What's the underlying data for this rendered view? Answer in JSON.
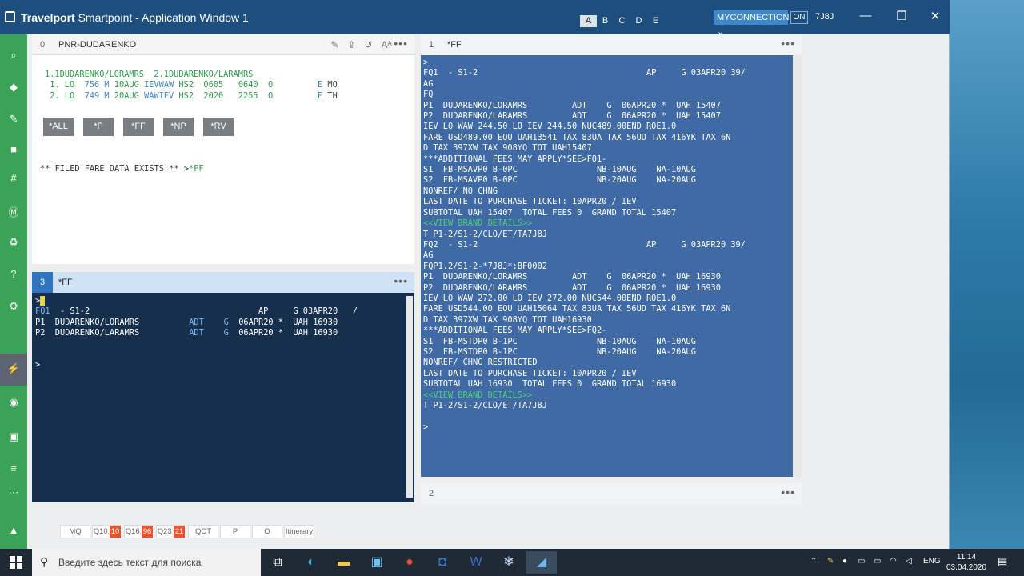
{
  "window": {
    "title_brand": "Travelport",
    "title_rest": " Smartpoint - Application Window 1",
    "tabs": [
      "A",
      "B",
      "C",
      "D",
      "E"
    ],
    "connection": "MYCONNECTION",
    "on_label": "ON",
    "pcc": "7J8J",
    "minimize": "—",
    "restore": "❐",
    "close": "✕"
  },
  "panel0": {
    "num": "0",
    "name": "PNR-DUDARENKO",
    "dots": "•••",
    "line1": "1.1DUDARENKO/LORAMRS  2.1DUDARENKO/LARAMRS",
    "seg1": {
      "idx": " 1. LO  ",
      "flt": "756 M",
      "date": " 10AUG ",
      "route": "IEVWAW",
      "hs": " HS2",
      "rest": "  0605   0640  O         ",
      "e": "E",
      "day": " MO"
    },
    "seg2": {
      "idx": " 2. LO  ",
      "flt": "749 M",
      "date": " 20AUG ",
      "route": "WAWIEV",
      "hs": " HS2",
      "rest": "  2020   2255  O         ",
      "e": "E",
      "day": " TH"
    },
    "buttons": [
      "*ALL",
      "*P",
      "*FF",
      "*NP",
      "*RV"
    ],
    "note_a": "** FILED FARE DATA EXISTS ** >",
    "note_b": "*FF"
  },
  "panel3": {
    "num": "3",
    "name": "*FF",
    "dots": "•••",
    "prompt": ">",
    "fq": "FQ1",
    "fq_rest": "  - S1-2                                  AP     G 03APR20   /",
    "p1a": "P1  DUDARENKO/LORAMRS          ",
    "p1b": "ADT",
    "p1c": "    ",
    "p1d": "G",
    "p1e": "  06APR20 *  UAH 16930",
    "p2a": "P2  DUDARENKO/LARAMRS          ",
    "p2b": "ADT",
    "p2c": "    ",
    "p2d": "G",
    "p2e": "  06APR20 *  UAH 16930",
    "prompt2": ">"
  },
  "panel1": {
    "num": "1",
    "name": "*FF",
    "dots": "•••",
    "lines": [
      ">",
      "FQ1  - S1-2                                  AP     G 03APR20 39/",
      "AG",
      "FQ",
      "P1  DUDARENKO/LORAMRS         ADT    G  06APR20 *  UAH 15407",
      "P2  DUDARENKO/LARAMRS         ADT    G  06APR20 *  UAH 15407",
      "IEV LO WAW 244.50 LO IEV 244.50 NUC489.00END ROE1.0",
      "FARE USD489.00 EQU UAH13541 TAX 83UA TAX 56UD TAX 416YK TAX 6N",
      "D TAX 397XW TAX 908YQ TOT UAH15407",
      "***ADDITIONAL FEES MAY APPLY*SEE>FQ1-",
      "S1  FB-MSAVP0 B-0PC                NB-10AUG    NA-10AUG",
      "S2  FB-MSAVP0 B-0PC                NB-20AUG    NA-20AUG",
      "NONREF/ NO CHNG",
      "LAST DATE TO PURCHASE TICKET: 10APR20 / IEV",
      "SUBTOTAL UAH 15407  TOTAL FEES 0  GRAND TOTAL 15407",
      "<<VIEW BRAND DETAILS>>",
      "T P1-2/S1-2/CLO/ET/TA7J8J",
      "FQ2  - S1-2                                  AP     G 03APR20 39/",
      "AG",
      "FQP1.2/S1-2-*7J8J*:BF0002",
      "P1  DUDARENKO/LORAMRS         ADT    G  06APR20 *  UAH 16930",
      "P2  DUDARENKO/LARAMRS         ADT    G  06APR20 *  UAH 16930",
      "IEV LO WAW 272.00 LO IEV 272.00 NUC544.00END ROE1.0",
      "FARE USD544.00 EQU UAH15064 TAX 83UA TAX 56UD TAX 416YK TAX 6N",
      "D TAX 397XW TAX 908YQ TOT UAH16930",
      "***ADDITIONAL FEES MAY APPLY*SEE>FQ2-",
      "S1  FB-MSTDP0 B-1PC                NB-10AUG    NA-10AUG",
      "S2  FB-MSTDP0 B-1PC                NB-20AUG    NA-20AUG",
      "NONREF/ CHNG RESTRICTED",
      "LAST DATE TO PURCHASE TICKET: 10APR20 / IEV",
      "SUBTOTAL UAH 16930  TOTAL FEES 0  GRAND TOTAL 16930",
      "<<VIEW BRAND DETAILS>>",
      "T P1-2/S1-2/CLO/ET/TA7J8J",
      "",
      ">"
    ]
  },
  "panel2": {
    "num": "2",
    "dots": "•••"
  },
  "bottom": {
    "mq": "MQ",
    "q10": "Q10",
    "q10c": "10",
    "q16": "Q16",
    "q16c": "96",
    "q23": "Q23",
    "q23c": "21",
    "qct": "QCT",
    "p": "P",
    "o": "O",
    "itin": "Itinerary"
  },
  "taskbar": {
    "search_placeholder": "Введите здесь текст для поиска",
    "lang": "ENG",
    "time": "11:14",
    "date": "03.04.2020"
  }
}
